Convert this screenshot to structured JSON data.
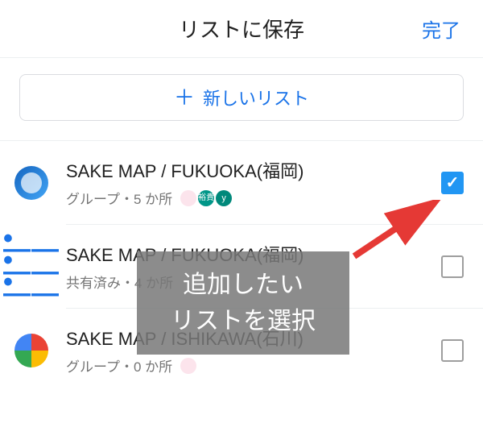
{
  "header": {
    "title": "リストに保存",
    "done": "完了"
  },
  "newList": {
    "label": "新しいリスト"
  },
  "rows": [
    {
      "title": "SAKE MAP / FUKUOKA(福岡)",
      "sub": "グループ・5 か所",
      "checked": true,
      "miniB": "裕貴",
      "miniC": "y"
    },
    {
      "title": "SAKE MAP / FUKUOKA(福岡)",
      "sub": "共有済み・4 か所",
      "checked": false
    },
    {
      "title": "SAKE MAP / ISHIKAWA(石川)",
      "sub": "グループ・0 か所",
      "checked": false
    }
  ],
  "overlay": {
    "line1": "追加したい",
    "line2": "リストを選択"
  }
}
